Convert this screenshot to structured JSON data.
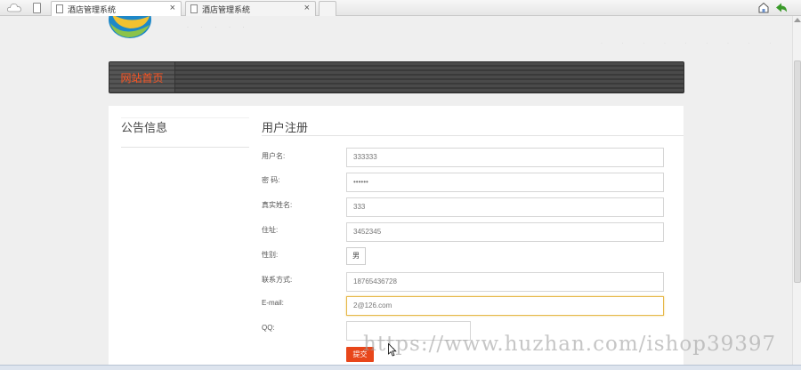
{
  "browser": {
    "tabs": [
      {
        "title": "酒店管理系统",
        "close": "×"
      },
      {
        "title": "酒店管理系统",
        "close": "×"
      }
    ]
  },
  "nav": {
    "home_label": "网站首页"
  },
  "sidebar": {
    "title": "公告信息"
  },
  "register": {
    "title": "用户注册",
    "fields": [
      {
        "label": "用户名:",
        "value": "333333"
      },
      {
        "label": "密 码:",
        "value": "••••••"
      },
      {
        "label": "真实姓名:",
        "value": "333"
      },
      {
        "label": "住址:",
        "value": "3452345"
      },
      {
        "label": "性别:",
        "value": "男"
      },
      {
        "label": "联系方式:",
        "value": "18765436728"
      },
      {
        "label": "E-mail:",
        "value": "2@126.com"
      },
      {
        "label": "QQ:",
        "value": ""
      }
    ],
    "submit_label": "提交"
  },
  "watermark": "https://www.huzhan.com/ishop39397",
  "colors": {
    "accent": "#e8461a",
    "nav_home_text": "#ff5522",
    "focus_border": "#e6b84a"
  }
}
